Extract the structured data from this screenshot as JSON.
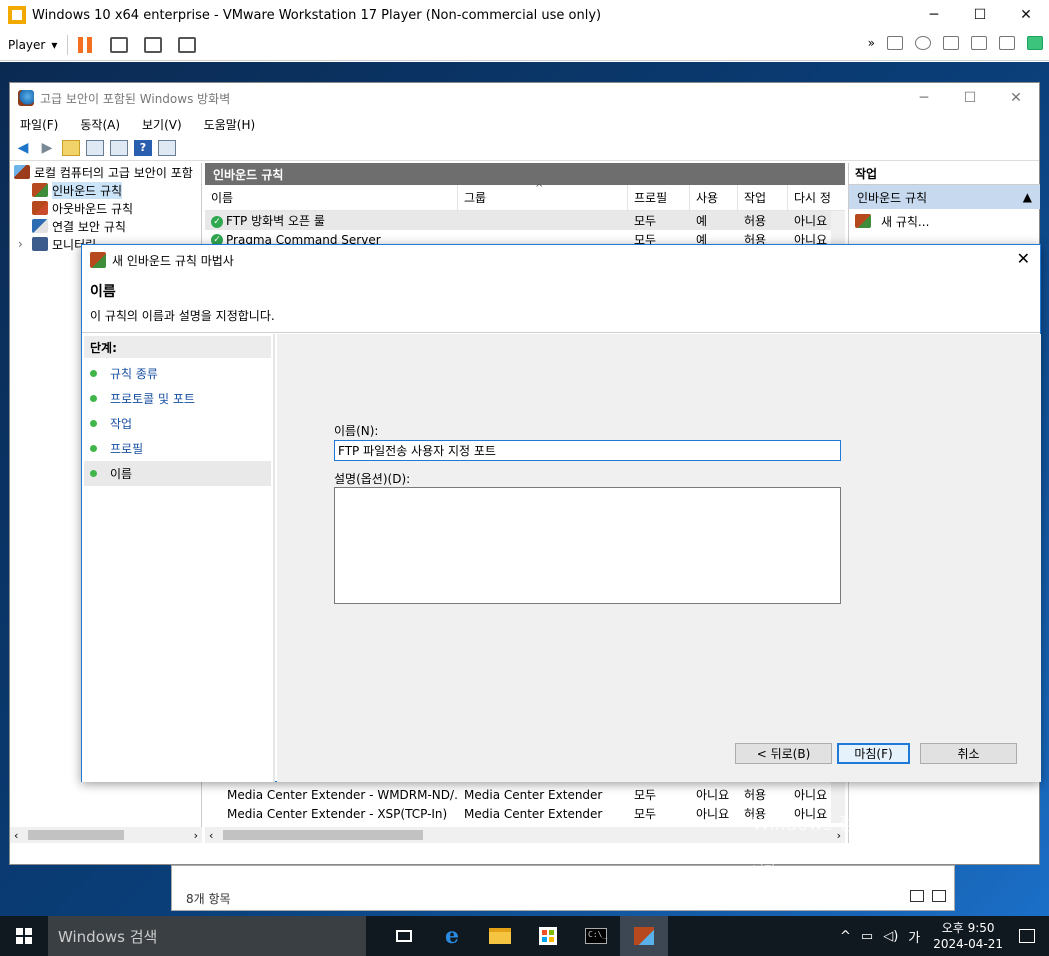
{
  "vmware": {
    "title": "Windows 10 x64 enterprise - VMware Workstation 17 Player (Non-commercial use only)",
    "player_menu": "Player",
    "window_controls": {
      "minimize": "─",
      "maximize": "☐",
      "close": "✕"
    },
    "right_toolbar_chevron": "»"
  },
  "firewall": {
    "title": "고급 보안이 포함된 Windows 방화벽",
    "window_controls": {
      "minimize": "─",
      "maximize": "☐",
      "close": "✕"
    },
    "menu": [
      "파일(F)",
      "동작(A)",
      "보기(V)",
      "도움말(H)"
    ],
    "tree": {
      "root": "로컬 컴퓨터의 고급 보안이 포함",
      "items": [
        "인바운드 규칙",
        "아웃바운드 규칙",
        "연결 보안 규칙",
        "모니터링"
      ]
    },
    "list": {
      "header": "인바운드 규칙",
      "columns": [
        "이름",
        "그룹",
        "프로필",
        "사용",
        "작업",
        "다시 정"
      ],
      "sort_indicator": "^",
      "rows": [
        {
          "name": "FTP 방화벽 오픈 룰",
          "group": "",
          "profile": "모두",
          "enabled": "예",
          "action": "허용",
          "override": "아니요"
        },
        {
          "name": "Pragma Command Server",
          "group": "",
          "profile": "모두",
          "enabled": "예",
          "action": "허용",
          "override": "아니요"
        }
      ],
      "bottom_rows": [
        {
          "name": "Media Center Extender - WMDRM-ND/...",
          "group": "Media Center Extender",
          "profile": "모두",
          "enabled": "아니요",
          "action": "허용",
          "override": "아니요"
        },
        {
          "name": "Media Center Extender - XSP(TCP-In)",
          "group": "Media Center Extender",
          "profile": "모두",
          "enabled": "아니요",
          "action": "허용",
          "override": "아니요"
        }
      ]
    },
    "actions": {
      "header": "작업",
      "section": "인바운드 규칙",
      "items": [
        "새 규칙..."
      ]
    }
  },
  "status_panel": {
    "count": "8개 항목"
  },
  "watermark": {
    "line1": "Windows 정품 인증",
    "line2": "[설정]으로 이동하여 Windows를 정품 인증합니다."
  },
  "wizard": {
    "title": "새 인바운드 규칙 마법사",
    "heading": "이름",
    "subheading": "이 규칙의 이름과 설명을 지정합니다.",
    "steps_header": "단계:",
    "steps": [
      "규칙 종류",
      "프로토콜 및 포트",
      "작업",
      "프로필",
      "이름"
    ],
    "current_step": 4,
    "name_label": "이름(N):",
    "name_value": "FTP 파일전송 사용자 지정 포트",
    "desc_label": "설명(옵션)(D):",
    "desc_value": "",
    "buttons": {
      "back": "< 뒤로(B)",
      "finish": "마침(F)",
      "cancel": "취소"
    },
    "close": "✕"
  },
  "taskbar": {
    "search_placeholder": "Windows 검색",
    "ime": "가",
    "time": "오후 9:50",
    "date": "2024-04-21",
    "tray_chevron": "^"
  }
}
